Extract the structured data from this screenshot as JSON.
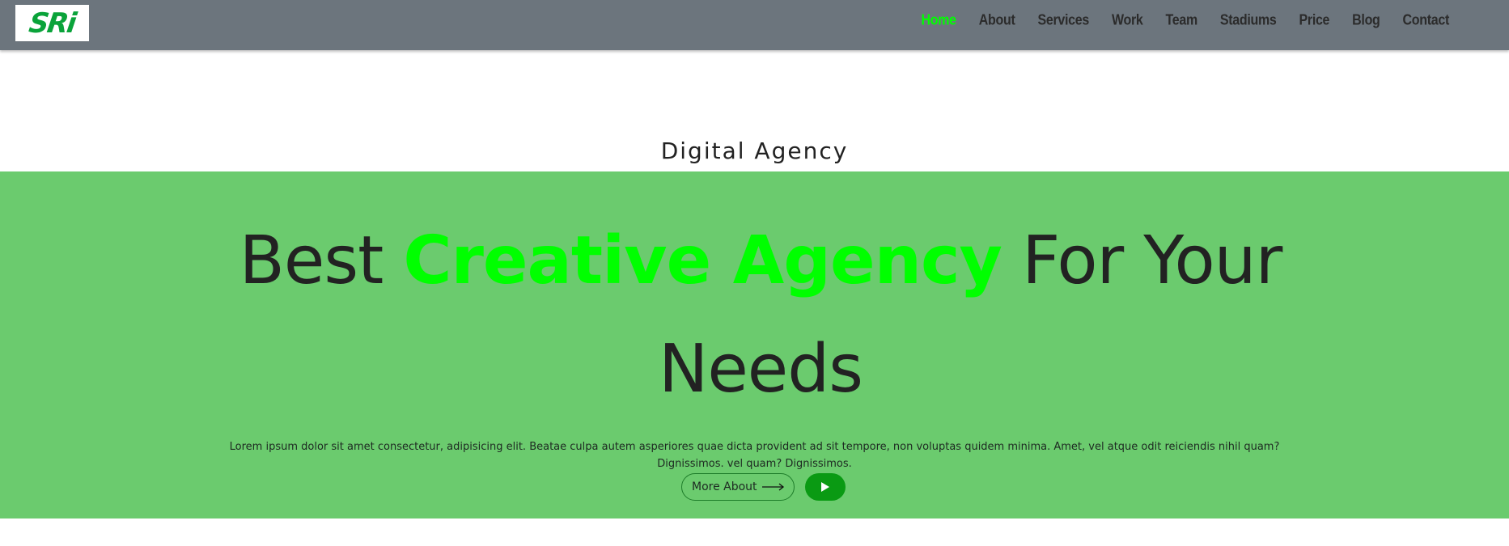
{
  "brand": {
    "logo_text": "SRi",
    "logo_color": "#0aa33a"
  },
  "nav": {
    "items": [
      {
        "label": "Home",
        "active": true
      },
      {
        "label": "About"
      },
      {
        "label": "Services"
      },
      {
        "label": "Work"
      },
      {
        "label": "Team"
      },
      {
        "label": "Stadiums"
      },
      {
        "label": "Price"
      },
      {
        "label": "Blog"
      },
      {
        "label": "Contact"
      }
    ],
    "active_color": "#00ff00",
    "bar_color": "#6c757d"
  },
  "hero": {
    "kicker": "Digital Agency",
    "headline_before": "Best ",
    "headline_highlight": "Creative Agency",
    "headline_after": " For Your Needs",
    "description": "Lorem ipsum dolor sit amet consectetur, adipisicing elit. Beatae culpa autem asperiores quae dicta provident ad sit tempore, non voluptas quidem minima. Amet, vel atque odit reiciendis nihil quam? Dignissimos. vel quam? Dignissimos.",
    "more_button_label": "More About",
    "more_button_icon": "arrow-right-icon",
    "play_button_icon": "play-icon",
    "background_color": "#6bcb6e",
    "highlight_color": "#00ff00"
  }
}
